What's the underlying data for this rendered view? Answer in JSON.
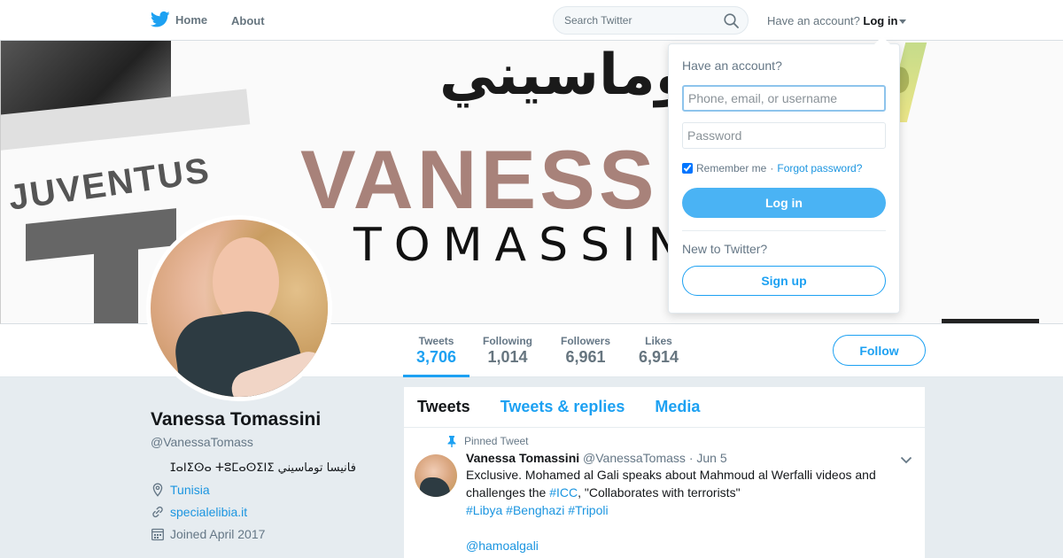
{
  "colors": {
    "accent": "#1da1f2",
    "link": "#1b95e0",
    "login_button_bg": "#4ab3f4",
    "page_bg": "#e6ecf0",
    "muted_text": "#657786"
  },
  "topnav": {
    "logo_icon": "twitter-bird-icon",
    "home_label": "Home",
    "about_label": "About",
    "search_placeholder": "Search Twitter",
    "search_icon": "search-icon",
    "have_account_text": "Have an account?",
    "login_label": "Log in"
  },
  "banner": {
    "arabic_text": "فانيسا توماسيني",
    "name_text": "VANESS",
    "surname_text": "TOMASSINI",
    "side_text": "JUVENTUS"
  },
  "login_dropdown": {
    "title": "Have an account?",
    "username_placeholder": "Phone, email, or username",
    "username_value": "",
    "password_placeholder": "Password",
    "password_value": "",
    "remember_label": "Remember me",
    "remember_checked": true,
    "separator": "·",
    "forgot_label": "Forgot password?",
    "login_button": "Log in",
    "new_prompt": "New to Twitter?",
    "signup_button": "Sign up"
  },
  "stats": [
    {
      "label": "Tweets",
      "value": "3,706",
      "active": true
    },
    {
      "label": "Following",
      "value": "1,014",
      "active": false
    },
    {
      "label": "Followers",
      "value": "6,961",
      "active": false
    },
    {
      "label": "Likes",
      "value": "6,914",
      "active": false
    }
  ],
  "follow_label": "Follow",
  "profile": {
    "name": "Vanessa Tomassini",
    "handle": "@VanessaTomass",
    "bio": "ⵊⴰⵏⵉⵙⴰ ⵜⵓⵎⴰⵙⵉⵏⵉ فانيسا توماسيني",
    "location": "Tunisia",
    "website": "specialelibia.it",
    "joined": "Joined April 2017",
    "location_icon": "location-pin-icon",
    "website_icon": "link-icon",
    "joined_icon": "calendar-icon"
  },
  "timeline": {
    "tabs": [
      {
        "label": "Tweets",
        "active": true
      },
      {
        "label": "Tweets & replies",
        "active": false
      },
      {
        "label": "Media",
        "active": false
      }
    ],
    "pinned_tweet": {
      "pinned_label": "Pinned Tweet",
      "pin_icon": "pin-icon",
      "author_name": "Vanessa Tomassini",
      "author_handle": "@VanessaTomass",
      "date": "· Jun 5",
      "text_part1": "Exclusive. Mohamed al Gali speaks about Mahmoud al Werfalli videos and challenges the ",
      "link_icc": "#ICC",
      "text_part2": ", \"Collaborates with terrorists\"",
      "hashtag_libya": "#Libya",
      "hashtag_benghazi": "#Benghazi",
      "hashtag_tripoli": "#Tripoli",
      "mention": "@hamoalgali",
      "caret_icon": "chevron-down-icon"
    }
  }
}
